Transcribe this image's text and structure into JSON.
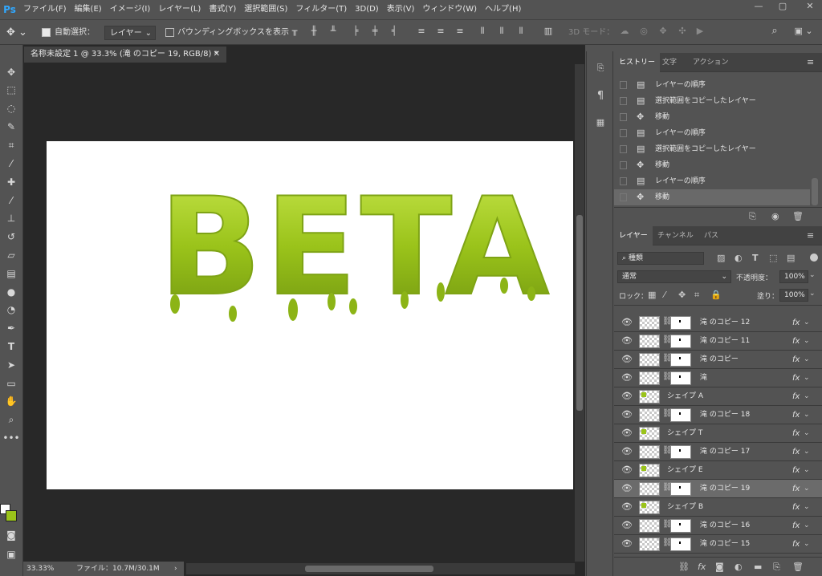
{
  "app": {
    "logo": "Ps"
  },
  "menu": [
    "ファイル(F)",
    "編集(E)",
    "イメージ(I)",
    "レイヤー(L)",
    "書式(Y)",
    "選択範囲(S)",
    "フィルター(T)",
    "3D(D)",
    "表示(V)",
    "ウィンドウ(W)",
    "ヘルプ(H)"
  ],
  "window_controls": {
    "minimize": "—",
    "restore": "▢",
    "close": "✕"
  },
  "options": {
    "auto_select_label": "自動選択：",
    "auto_select_target": "レイヤー",
    "bounding_box_label": "バウンディングボックスを表示",
    "mode_3d_label": "3D モード："
  },
  "document": {
    "tab_title": "名称未設定 1 @ 33.3% (滝 のコピー 19, RGB/8) *",
    "canvas_text": "BETA",
    "zoom": "33.33%",
    "file_info": "ファイル：10.7M/30.1M"
  },
  "history_panel": {
    "tabs": [
      "ヒストリー",
      "文字",
      "アクション"
    ],
    "items": [
      {
        "icon": "doc",
        "label": "レイヤーの順序"
      },
      {
        "icon": "doc",
        "label": "選択範囲をコピーしたレイヤー"
      },
      {
        "icon": "move",
        "label": "移動"
      },
      {
        "icon": "doc",
        "label": "レイヤーの順序"
      },
      {
        "icon": "doc",
        "label": "選択範囲をコピーしたレイヤー"
      },
      {
        "icon": "move",
        "label": "移動"
      },
      {
        "icon": "doc",
        "label": "レイヤーの順序"
      },
      {
        "icon": "move",
        "label": "移動"
      }
    ]
  },
  "layers_panel": {
    "tabs": [
      "レイヤー",
      "チャンネル",
      "パス"
    ],
    "filter_kind": "種類",
    "blend_mode": "通常",
    "opacity_label": "不透明度：",
    "opacity_value": "100%",
    "lock_label": "ロック：",
    "fill_label": "塗り：",
    "fill_value": "100%",
    "layers": [
      {
        "name": "滝 のコピー 12",
        "kind": "pixel",
        "fx": "fx"
      },
      {
        "name": "滝 のコピー 11",
        "kind": "pixel",
        "fx": "fx"
      },
      {
        "name": "滝 のコピー",
        "kind": "pixel",
        "fx": "fx"
      },
      {
        "name": "滝",
        "kind": "pixel",
        "fx": "fx"
      },
      {
        "name": "シェイプ A",
        "kind": "shape",
        "fx": "fx"
      },
      {
        "name": "滝 のコピー 18",
        "kind": "pixel",
        "fx": "fx"
      },
      {
        "name": "シェイプ T",
        "kind": "shape",
        "fx": "fx"
      },
      {
        "name": "滝 のコピー 17",
        "kind": "pixel",
        "fx": "fx"
      },
      {
        "name": "シェイプ E",
        "kind": "shape",
        "fx": "fx"
      },
      {
        "name": "滝 のコピー 19",
        "kind": "pixel",
        "fx": "fx",
        "selected": true
      },
      {
        "name": "シェイプ B",
        "kind": "shape",
        "fx": "fx"
      },
      {
        "name": "滝 のコピー 16",
        "kind": "pixel",
        "fx": "fx"
      },
      {
        "name": "滝 のコピー 15",
        "kind": "pixel",
        "fx": "fx"
      }
    ]
  },
  "colors": {
    "slime": "#9ac31a",
    "slime_dark": "#6f9410",
    "foreground": "#ffffff",
    "background": "#9ac31a"
  }
}
